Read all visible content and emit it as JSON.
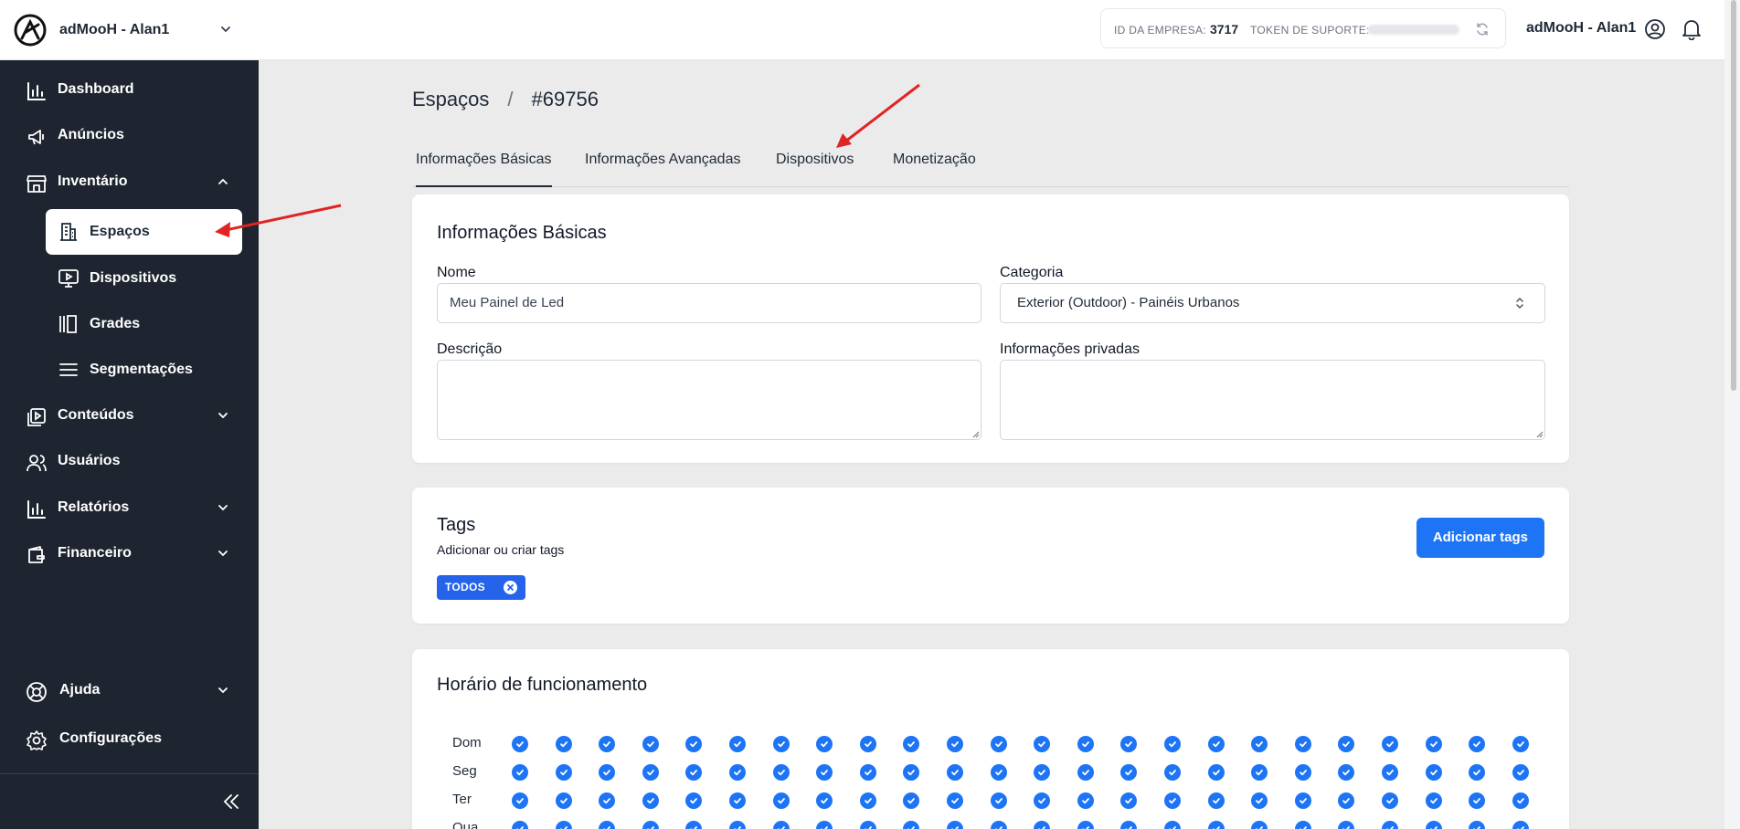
{
  "org": {
    "name": "adMooH - Alan1"
  },
  "sidebar": {
    "items": [
      {
        "label": "Dashboard",
        "icon": "bar-chart-icon"
      },
      {
        "label": "Anúncios",
        "icon": "megaphone-icon"
      },
      {
        "label": "Inventário",
        "icon": "store-icon"
      },
      {
        "label": "Conteúdos",
        "icon": "media-icon"
      },
      {
        "label": "Usuários",
        "icon": "users-icon"
      },
      {
        "label": "Relatórios",
        "icon": "bar-chart-icon"
      },
      {
        "label": "Financeiro",
        "icon": "wallet-icon"
      }
    ],
    "inventory_sub": [
      {
        "label": "Espaços",
        "icon": "building-icon"
      },
      {
        "label": "Dispositivos",
        "icon": "monitor-play-icon"
      },
      {
        "label": "Grades",
        "icon": "columns-icon"
      },
      {
        "label": "Segmentações",
        "icon": "menu-lines-icon"
      }
    ],
    "bottom": [
      {
        "label": "Ajuda",
        "icon": "lifebuoy-icon"
      },
      {
        "label": "Configurações",
        "icon": "gear-icon"
      }
    ]
  },
  "header": {
    "company_id_label": "ID DA EMPRESA:",
    "company_id": "3717",
    "support_token_label": "TOKEN DE SUPORTE:",
    "user_name": "adMooH - Alan1"
  },
  "breadcrumb": {
    "root": "Espaços",
    "separator": "/",
    "current": "#69756"
  },
  "tabs": [
    "Informações Básicas",
    "Informações Avançadas",
    "Dispositivos",
    "Monetização"
  ],
  "basic_info": {
    "title": "Informações Básicas",
    "name_label": "Nome",
    "name_value": "Meu Painel de Led",
    "category_label": "Categoria",
    "category_value": "Exterior (Outdoor) - Painéis Urbanos",
    "description_label": "Descrição",
    "private_label": "Informações privadas"
  },
  "tags": {
    "title": "Tags",
    "subtitle": "Adicionar ou criar tags",
    "add_button": "Adicionar tags",
    "chips": [
      "TODOS"
    ]
  },
  "schedule": {
    "title": "Horário de funcionamento",
    "days": [
      "Dom",
      "Seg",
      "Ter",
      "Qua"
    ],
    "hours_per_day": 24
  },
  "colors": {
    "sidebar": "#1e2530",
    "primary": "#1d74f5",
    "arrow": "#e02424"
  }
}
